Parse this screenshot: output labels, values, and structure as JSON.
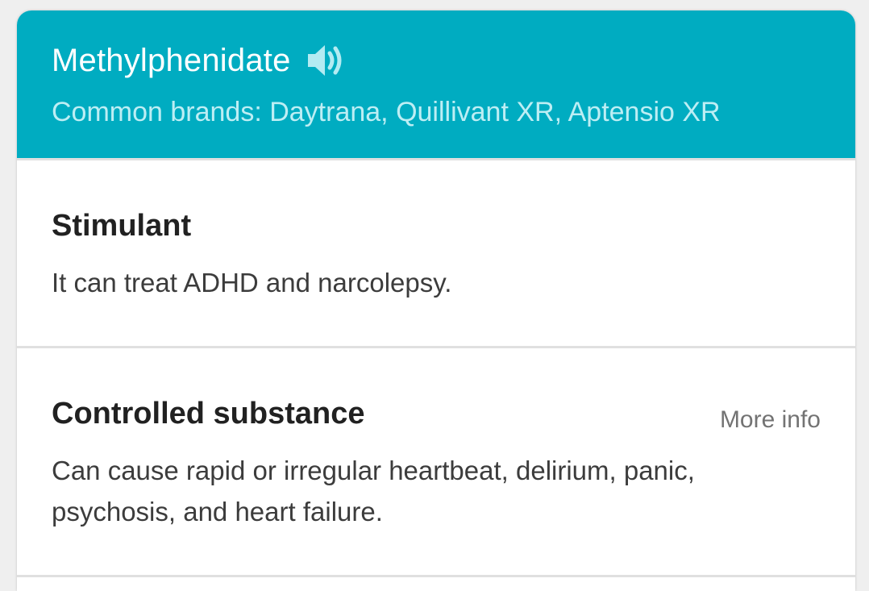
{
  "drug": {
    "name": "Methylphenidate",
    "brands": "Common brands: Daytrana, Quillivant XR, Aptensio XR",
    "speaker_icon": "speaker-icon"
  },
  "sections": [
    {
      "title": "Stimulant",
      "text": "It can treat ADHD and narcolepsy."
    },
    {
      "title": "Controlled substance",
      "text": "Can cause rapid or irregular heartbeat, delirium, panic, psychosis, and heart failure.",
      "more_label": "More info"
    }
  ],
  "colors": {
    "header": "#00acc1",
    "brands_text": "#bdeef4"
  }
}
